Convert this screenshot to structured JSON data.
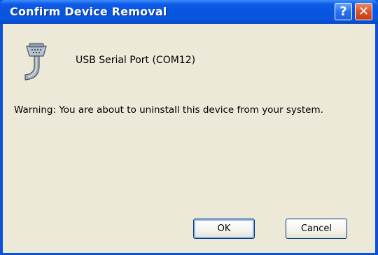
{
  "window": {
    "title": "Confirm Device Removal",
    "help_label": "?",
    "close_label": "✕"
  },
  "device": {
    "icon": "serial-port-cable-icon",
    "name": "USB Serial Port (COM12)"
  },
  "message": {
    "warning": "Warning: You are about to uninstall this device from your system."
  },
  "buttons": {
    "ok_label": "OK",
    "cancel_label": "Cancel"
  },
  "colors": {
    "titlebar": "#0655dd",
    "client_background": "#ece9d8",
    "close_button": "#d9542a"
  }
}
